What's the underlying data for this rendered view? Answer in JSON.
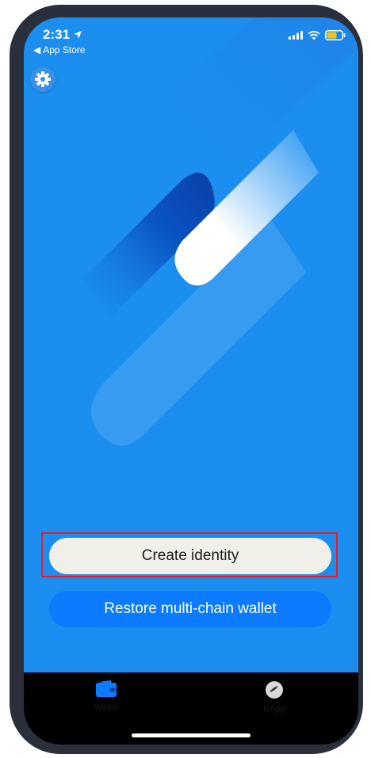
{
  "status_bar": {
    "time": "2:31",
    "back_label": "App Store"
  },
  "colors": {
    "background": "#1b8ef0",
    "create_button_bg": "#f0f0e8",
    "restore_button_bg": "#0d7bff",
    "battery": "#f5c518",
    "tab_active": "#0d7bff",
    "highlight_box": "#e0202e"
  },
  "header": {
    "settings_icon": "gear-icon"
  },
  "actions": {
    "create_label": "Create identity",
    "restore_label": "Restore multi-chain wallet"
  },
  "tabs": [
    {
      "label": "Wallet",
      "icon": "wallet-icon",
      "active": true
    },
    {
      "label": "DApp",
      "icon": "dapp-icon",
      "active": false
    }
  ]
}
